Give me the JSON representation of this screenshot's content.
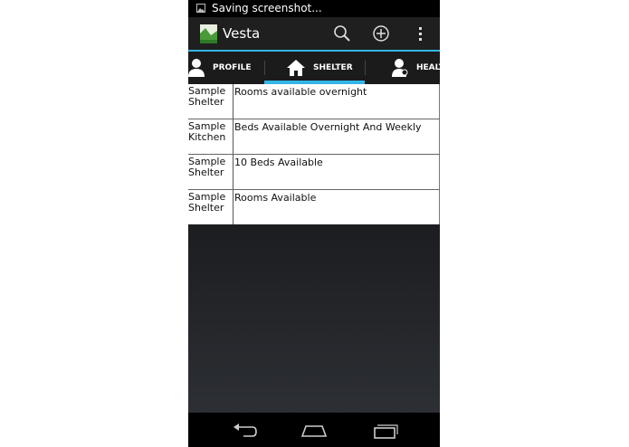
{
  "statusbar": {
    "text": "Saving screenshot..."
  },
  "actionbar": {
    "title": "Vesta",
    "icons": [
      "search-icon",
      "add-icon",
      "overflow-menu-icon"
    ],
    "accent": "#33b5e5"
  },
  "tabs": [
    {
      "label": "PROFILE",
      "icon": "person-icon"
    },
    {
      "label": "SHELTER",
      "icon": "house-icon",
      "selected": true
    },
    {
      "label": "HEALT",
      "icon": "health-icon"
    }
  ],
  "list": [
    {
      "name": "Sample Shelter",
      "description": "Rooms available overnight"
    },
    {
      "name": "Sample Kitchen",
      "description": "Beds Available Overnight And Weekly"
    },
    {
      "name": "Sample Shelter",
      "description": "10 Beds Available"
    },
    {
      "name": "Sample Shelter",
      "description": "Rooms Available"
    }
  ],
  "navbar": {
    "icons": [
      "back-icon",
      "home-icon",
      "recents-icon"
    ]
  }
}
